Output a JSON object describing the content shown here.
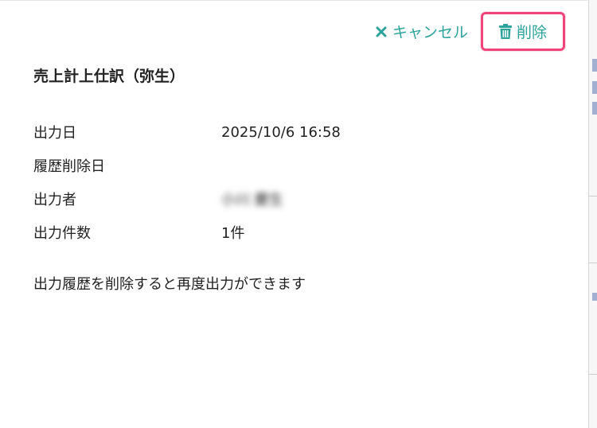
{
  "dialog": {
    "title": "売上計上仕訳（弥生）",
    "cancel_label": "キャンセル",
    "delete_label": "削除",
    "note": "出力履歴を削除すると再度出力ができます"
  },
  "details": [
    {
      "label": "出力日",
      "value": "2025/10/6 16:58"
    },
    {
      "label": "履歴削除日",
      "value": ""
    },
    {
      "label": "出力者",
      "value": "小川 慶生"
    },
    {
      "label": "出力件数",
      "value": "1件"
    }
  ],
  "colors": {
    "accent": "#2ba39a",
    "highlight": "#f0457a"
  }
}
